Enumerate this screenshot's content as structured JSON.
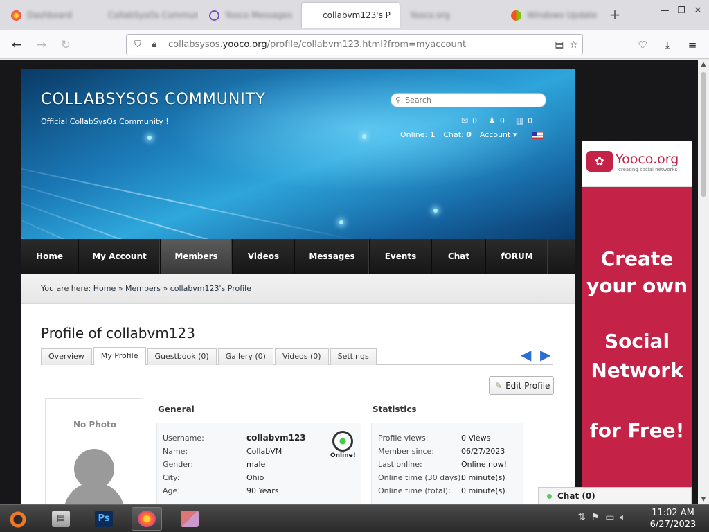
{
  "browser": {
    "tabs": [
      {
        "label": "Dashboard",
        "blurred": true,
        "icon": "firefox-icon"
      },
      {
        "label": "CollabSysOs Community",
        "blurred": true,
        "icon": "page-icon"
      },
      {
        "label": "Yooco Messages",
        "blurred": true,
        "icon": "at-icon"
      },
      {
        "label": "collabvm123's P",
        "blurred": false,
        "active": true,
        "icon": "none"
      },
      {
        "label": "Yooco.org",
        "blurred": true,
        "icon": "page-icon"
      },
      {
        "label": "Windows Update",
        "blurred": true,
        "icon": "windows-icon"
      }
    ],
    "url_prefix": "collabsysos.",
    "url_domain": "yooco.org",
    "url_path": "/profile/collabvm123.html?from=myaccount"
  },
  "site": {
    "title": "COLLABSYSOS COMMUNITY",
    "subtitle": "Official CollabSysOs Community !",
    "search_placeholder": "Search",
    "counters": {
      "messages": "0",
      "friends": "0",
      "notes": "0"
    },
    "online_label": "Online:",
    "online_value": "1",
    "chat_label": "Chat:",
    "chat_value": "0",
    "account_label": "Account ▾"
  },
  "menu": [
    "Home",
    "My Account",
    "Members",
    "Videos",
    "Messages",
    "Events",
    "Chat",
    "fORUM"
  ],
  "menu_active": "Members",
  "breadcrumb": {
    "prefix": "You are here:",
    "items": [
      "Home",
      "Members",
      "collabvm123's Profile"
    ],
    "separator": "»"
  },
  "profile": {
    "title": "Profile of collabvm123",
    "tabs": [
      "Overview",
      "My Profile",
      "Guestbook (0)",
      "Gallery (0)",
      "Videos (0)",
      "Settings"
    ],
    "active_tab": "My Profile",
    "edit_button": "Edit Profile",
    "no_photo": "No Photo",
    "online_badge": "Online!",
    "general": {
      "heading": "General",
      "rows": [
        {
          "label": "Username:",
          "value": "collabvm123"
        },
        {
          "label": "Name:",
          "value": "CollabVM"
        },
        {
          "label": "Gender:",
          "value": "male"
        },
        {
          "label": "City:",
          "value": "Ohio"
        },
        {
          "label": "Age:",
          "value": "90 Years"
        }
      ]
    },
    "statistics": {
      "heading": "Statistics",
      "rows": [
        {
          "label": "Profile views:",
          "value": "0 Views"
        },
        {
          "label": "Member since:",
          "value": "06/27/2023"
        },
        {
          "label": "Last online:",
          "value": "Online now!"
        },
        {
          "label": "Online time (30 days):",
          "value": "0 minute(s)"
        },
        {
          "label": "Online time (total):",
          "value": "0 minute(s)"
        }
      ]
    }
  },
  "ad": {
    "brand": "Yooco.org",
    "tagline": "creating social networks",
    "lines": [
      "Create",
      "your own",
      "Social",
      "Network",
      "for Free!"
    ]
  },
  "chatbar": {
    "label": "Chat (0)"
  },
  "taskbar": {
    "time": "11:02 AM",
    "date": "6/27/2023"
  },
  "colors": {
    "accent_blue": "#2a6fd1",
    "ad_red": "#c42246",
    "menu_dark": "#1f1f1f"
  }
}
